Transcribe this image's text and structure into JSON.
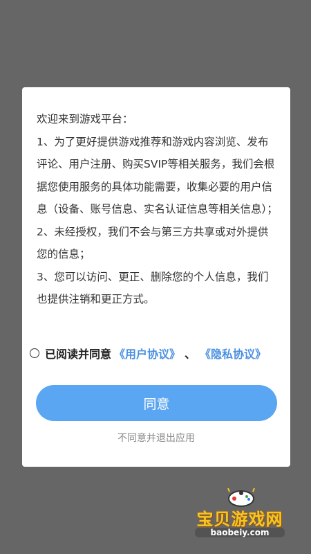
{
  "dialog": {
    "greeting": "欢迎来到游戏平台：",
    "item1": "1、为了更好提供游戏推荐和游戏内容浏览、发布评论、用户注册、购买SVIP等相关服务，我们会根据您使用服务的具体功能需要，收集必要的用户信息（设备、账号信息、实名认证信息等相关信息）；",
    "item2": "2、未经授权，我们不会与第三方共享或对外提供您的信息；",
    "item3": "3、您可以访问、更正、删除您的个人信息，我们也提供注销和更正方式。",
    "agree_prefix": "已阅读并同意",
    "user_agreement_link": "《用户协议》",
    "separator": "、",
    "privacy_link": "《隐私协议》",
    "agree_button": "同意",
    "reject_link": "不同意并退出应用"
  },
  "watermark": {
    "title": "宝贝游戏网",
    "url": "baobeiy.com"
  },
  "colors": {
    "accent": "#5ba6f2",
    "link": "#4a90e2",
    "overlay": "#666666"
  }
}
